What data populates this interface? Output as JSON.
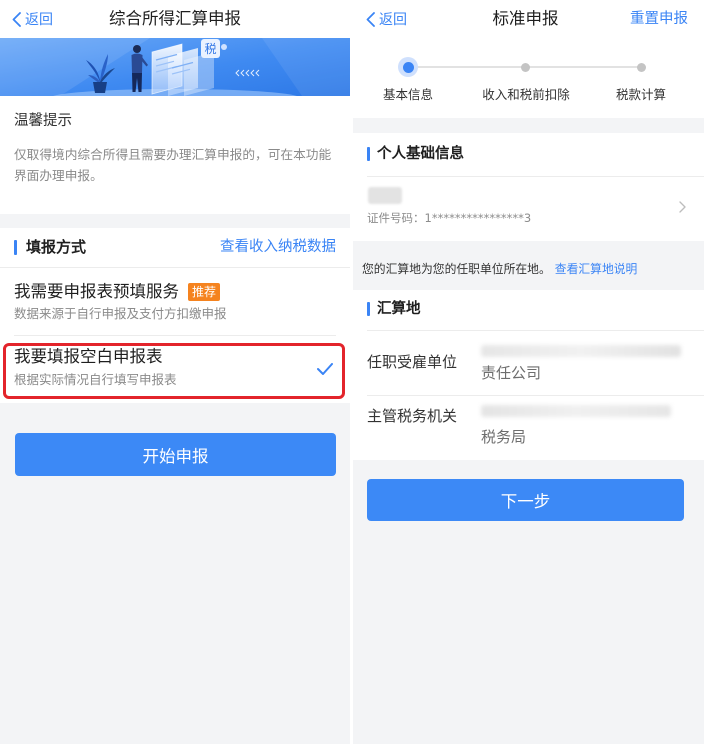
{
  "colors": {
    "accent": "#3a84f5",
    "button": "#3c89f6",
    "badge": "#f5831f",
    "highlight": "#e3242b",
    "page_bg": "#f3f4f6"
  },
  "left_screen": {
    "header": {
      "back_label": "返回",
      "title": "综合所得汇算申报"
    },
    "banner": {
      "badge_text": "税"
    },
    "tips": {
      "title": "温馨提示",
      "text": "仅取得境内综合所得且需要办理汇算申报的，可在本功能界面办理申报。"
    },
    "filing_method": {
      "title": "填报方式",
      "link": "查看收入纳税数据",
      "options": [
        {
          "title": "我需要申报表预填服务",
          "badge": "推荐",
          "subtitle": "数据来源于自行申报及支付方扣缴申报",
          "selected": false
        },
        {
          "title": "我要填报空白申报表",
          "subtitle": "根据实际情况自行填写申报表",
          "selected": true
        }
      ]
    },
    "start_button": "开始申报"
  },
  "right_screen": {
    "header": {
      "back_label": "返回",
      "title": "标准申报",
      "reset_label": "重置申报"
    },
    "steps": [
      {
        "label": "基本信息",
        "active": true
      },
      {
        "label": "收入和税前扣除",
        "active": false
      },
      {
        "label": "税款计算",
        "active": false
      }
    ],
    "personal_info": {
      "title": "个人基础信息",
      "id_text": "证件号码：1****************3"
    },
    "notice": {
      "text": "您的汇算地为您的任职单位所在地。",
      "link": "查看汇算地说明"
    },
    "settlement": {
      "title": "汇算地",
      "rows": [
        {
          "label": "任职受雇单位",
          "value": "责任公司"
        },
        {
          "label": "主管税务机关",
          "value": "税务局"
        }
      ]
    },
    "next_button": "下一步"
  }
}
